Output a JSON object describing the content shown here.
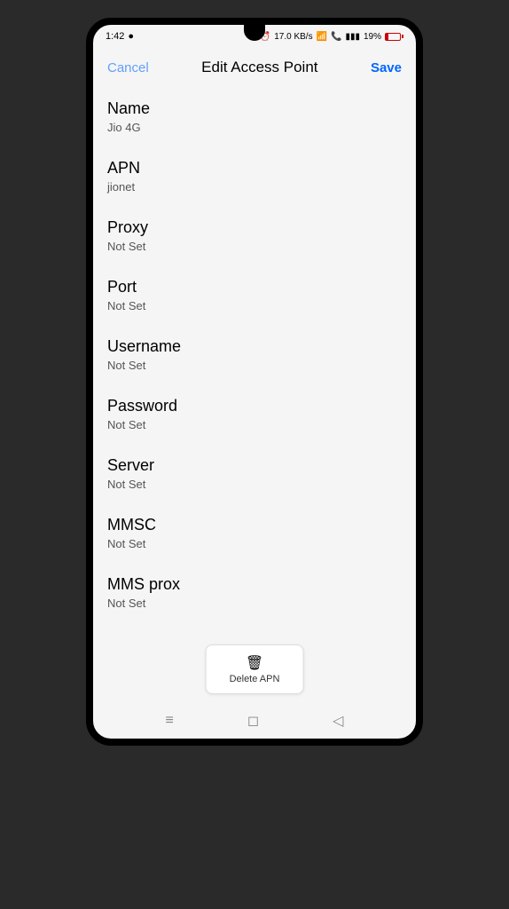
{
  "status_bar": {
    "time": "1:42",
    "network_speed": "17.0 KB/s",
    "battery_percent": "19%"
  },
  "header": {
    "cancel_label": "Cancel",
    "title": "Edit Access Point",
    "save_label": "Save"
  },
  "fields": [
    {
      "label": "Name",
      "value": "Jio 4G"
    },
    {
      "label": "APN",
      "value": "jionet"
    },
    {
      "label": "Proxy",
      "value": "Not Set"
    },
    {
      "label": "Port",
      "value": "Not Set"
    },
    {
      "label": "Username",
      "value": "Not Set"
    },
    {
      "label": "Password",
      "value": "Not Set"
    },
    {
      "label": "Server",
      "value": "Not Set"
    },
    {
      "label": "MMSC",
      "value": "Not Set"
    },
    {
      "label": "MMS prox",
      "value": "Not Set"
    }
  ],
  "delete_button": {
    "label": "Delete APN"
  }
}
